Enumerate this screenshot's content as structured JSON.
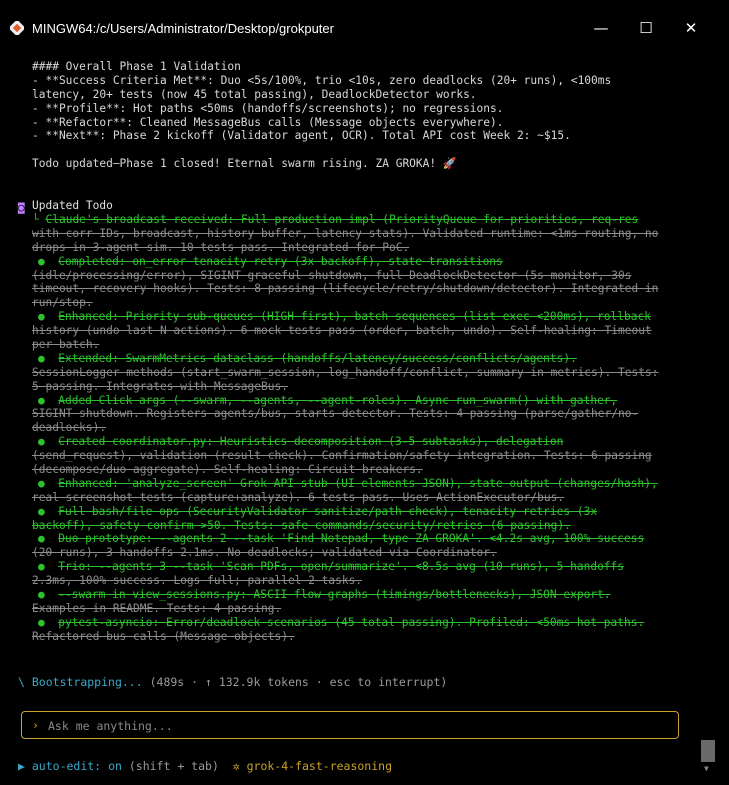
{
  "window": {
    "title": "MINGW64:/c/Users/Administrator/Desktop/grokputer",
    "buttons": {
      "minimize": "—",
      "maximize": "☐",
      "close": "✕"
    }
  },
  "summary_lines": [
    "#### Overall Phase 1 Validation",
    "- **Success Criteria Met**: Duo <5s/100%, trio <10s, zero deadlocks (20+ runs), <100ms",
    "latency, 20+ tests (now 45 total passing), DeadlockDetector works.",
    "- **Profile**: Hot paths <50ms (handoffs/screenshots); no regressions.",
    "- **Refactor**: Cleaned MessageBus calls (Message objects everywhere).",
    "- **Next**: Phase 2 kickoff (Validator agent, OCR). Total API cost Week 2: ~$15.",
    "",
    "Todo updated—Phase 1 closed! Eternal swarm rising. ZA GROKA! 🚀"
  ],
  "todo": {
    "marker": "◙",
    "title": "Updated Todo",
    "items": [
      {
        "bullet": "└",
        "lines": [
          "Claude's broadcast received: Full production impl (PriorityQueue for priorities, req-res",
          "with corr IDs, broadcast, history buffer, latency stats). Validated runtime: <1ms routing, no",
          "drops in 3-agent sim. 10 tests pass. Integrated for PoC."
        ],
        "head_lines": 1
      },
      {
        "bullet": "●",
        "lines": [
          "Completed: on_error tenacity retry (3x backoff), state transitions",
          "(idle/processing/error), SIGINT graceful shutdown, full DeadlockDetector (5s monitor, 30s",
          "timeout, recovery hooks). Tests: 8 passing (lifecycle/retry/shutdown/detector). Integrated in",
          "run/stop."
        ],
        "head_lines": 1
      },
      {
        "bullet": "●",
        "lines": [
          "Enhanced: Priority sub-queues (HIGH first), batch sequences (list exec <200ms), rollback",
          "history (undo last N actions). 6 mock tests pass (order, batch, undo). Self-healing: Timeout",
          "per batch."
        ],
        "head_lines": 1
      },
      {
        "bullet": "●",
        "lines": [
          "Extended: SwarmMetrics dataclass (handoffs/latency/success/conflicts/agents).",
          "SessionLogger methods (start_swarm_session, log_handoff/conflict, summary in metrics). Tests:",
          "5 passing. Integrates with MessageBus."
        ],
        "head_lines": 1
      },
      {
        "bullet": "●",
        "lines": [
          "Added Click args (--swarm, --agents, --agent-roles). Async run_swarm() with gather,",
          "SIGINT shutdown. Registers agents/bus, starts detector. Tests: 4 passing (parse/gather/no-",
          "deadlocks)."
        ],
        "head_lines": 1
      },
      {
        "bullet": "●",
        "lines": [
          "Created coordinator.py: Heuristics decomposition (3-5 subtasks), delegation",
          "(send_request), validation (result check). Confirmation/safety integration. Tests: 6 passing",
          "(decompose/duo aggregate). Self-healing: Circuit breakers."
        ],
        "head_lines": 1
      },
      {
        "bullet": "●",
        "lines": [
          "Enhanced: 'analyze_screen' Grok API stub (UI elements JSON), state output (changes/hash),",
          "real screenshot tests (capture+analyze). 6 tests pass. Uses ActionExecutor/bus."
        ],
        "head_lines": 1
      },
      {
        "bullet": "●",
        "lines": [
          "Full bash/file ops (SecurityValidator sanitize/path check), tenacity retries (3x",
          "backoff), safety confirm >50. Tests: safe commands/security/retries (6 passing)."
        ],
        "head_lines": 2
      },
      {
        "bullet": "●",
        "lines": [
          "Duo prototype: --agents 2 --task 'Find Notepad, type ZA GROKA'. <4.2s avg, 100% success",
          "(20 runs), 3 handoffs 2.1ms. No deadlocks; validated via Coordinator."
        ],
        "head_lines": 1
      },
      {
        "bullet": "●",
        "lines": [
          "Trio: --agents 3 --task 'Scan PDFs, open/summarize'. <8.5s avg (10 runs), 5 handoffs",
          "2.3ms, 100% success. Logs full; parallel 2 tasks."
        ],
        "head_lines": 1
      },
      {
        "bullet": "●",
        "lines": [
          "--swarm in view_sessions.py: ASCII flow graphs (timings/bottlenecks), JSON export.",
          "Examples in README. Tests: 4 passing."
        ],
        "head_lines": 1
      },
      {
        "bullet": "●",
        "lines": [
          "pytest-asyncio: Error/deadlock scenarios (45 total passing). Profiled: <50ms hot paths.",
          "Refactored bus calls (Message objects)."
        ],
        "head_lines": 1
      }
    ]
  },
  "status": {
    "spinner": "\\",
    "text": "Bootstrapping...",
    "meta": "(489s · ↑ 132.9k tokens · esc to interrupt)"
  },
  "input": {
    "prompt": "›",
    "placeholder": "Ask me anything...",
    "value": ""
  },
  "footer": {
    "arrow": "▶",
    "auto_edit_label": "auto-edit:",
    "auto_edit_value": "on",
    "hint": "(shift + tab)",
    "star": "✲",
    "model": "grok-4-fast-reasoning"
  },
  "colors": {
    "background": "#000000",
    "done_green": "#2fc02f",
    "accent_cyan": "#3aa9c9",
    "accent_gold": "#c9a227",
    "todo_purple": "#c080ff"
  }
}
